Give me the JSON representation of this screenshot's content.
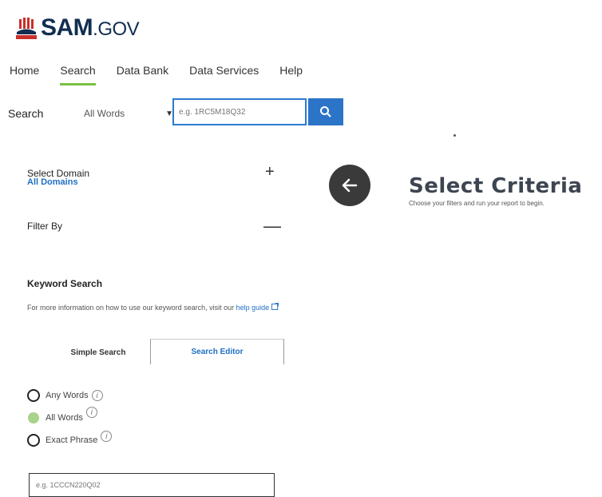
{
  "logo": {
    "text_main": "SAM",
    "text_suffix": ".GOV",
    "mark": "capitol-flag-icon"
  },
  "nav": [
    {
      "label": "Home",
      "active": false
    },
    {
      "label": "Search",
      "active": true
    },
    {
      "label": "Data Bank",
      "active": false
    },
    {
      "label": "Data Services",
      "active": false
    },
    {
      "label": "Help",
      "active": false
    }
  ],
  "search": {
    "label": "Search",
    "mode": "All Words",
    "placeholder": "e.g. 1RC5M18Q32",
    "button_icon": "search-icon"
  },
  "filters": {
    "select_domain_label": "Select Domain",
    "domain_value": "All Domains",
    "expand_symbol": "+",
    "filter_by_label": "Filter By",
    "collapse_symbol": "—"
  },
  "keyword": {
    "title": "Keyword Search",
    "help_text": "For more information on how to use our keyword search, visit our",
    "help_link": "help guide",
    "tabs": {
      "simple": "Simple Search",
      "editor": "Search Editor"
    },
    "options": [
      {
        "label": "Any Words",
        "checked": false
      },
      {
        "label": "All Words",
        "checked": true
      },
      {
        "label": "Exact Phrase",
        "checked": false
      }
    ],
    "info_symbol": "i",
    "input_placeholder": "e.g. 1CCCN220Q02"
  },
  "criteria": {
    "title": "Select Criteria",
    "subtitle": "Choose your filters and run your report to begin."
  },
  "colors": {
    "brand": "#112e51",
    "accent": "#7ac143",
    "link": "#1e6fc6",
    "button": "#2b74c7"
  }
}
